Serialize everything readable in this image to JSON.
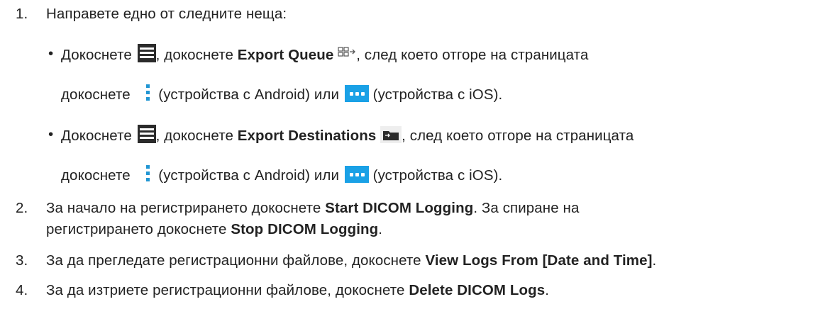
{
  "steps": [
    {
      "num": "1.",
      "text": "Направете едно от следните неща:"
    },
    {
      "num": "2.",
      "line1_a": "За начало на регистрирането докоснете ",
      "line1_b": "Start DICOM Logging",
      "line1_c": ". За спиране на",
      "line2_a": "регистрирането докоснете ",
      "line2_b": "Stop DICOM Logging",
      "line2_c": "."
    },
    {
      "num": "3.",
      "a": "За да прегледате регистрационни файлове, докоснете ",
      "b": "View Logs From [Date and Time]",
      "c": "."
    },
    {
      "num": "4.",
      "a": "За да изтриете регистрационни файлове, докоснете ",
      "b": "Delete DICOM Logs",
      "c": "."
    }
  ],
  "bullets": [
    {
      "bullet": "•",
      "a": "Докоснете ",
      "b": ", докоснете ",
      "c": "Export Queue",
      "d": ", след което отгоре на страницата",
      "e": "докоснете ",
      "f": " (устройства с Android) или ",
      "g": " (устройства с iOS).",
      "icon_main": "menu-icon",
      "icon_target": "export-queue-icon"
    },
    {
      "bullet": "•",
      "a": "Докоснете ",
      "b": ", докоснете ",
      "c": "Export Destinations",
      "d": ", след което отгоре на страницата",
      "e": "докоснете ",
      "f": " (устройства с Android) или ",
      "g": " (устройства с iOS).",
      "icon_main": "menu-icon",
      "icon_target": "export-destinations-icon"
    }
  ],
  "icons": {
    "android_more": "vertical-dots-icon",
    "ios_more": "ios-more-icon",
    "accent_color": "#1aa1e6"
  }
}
